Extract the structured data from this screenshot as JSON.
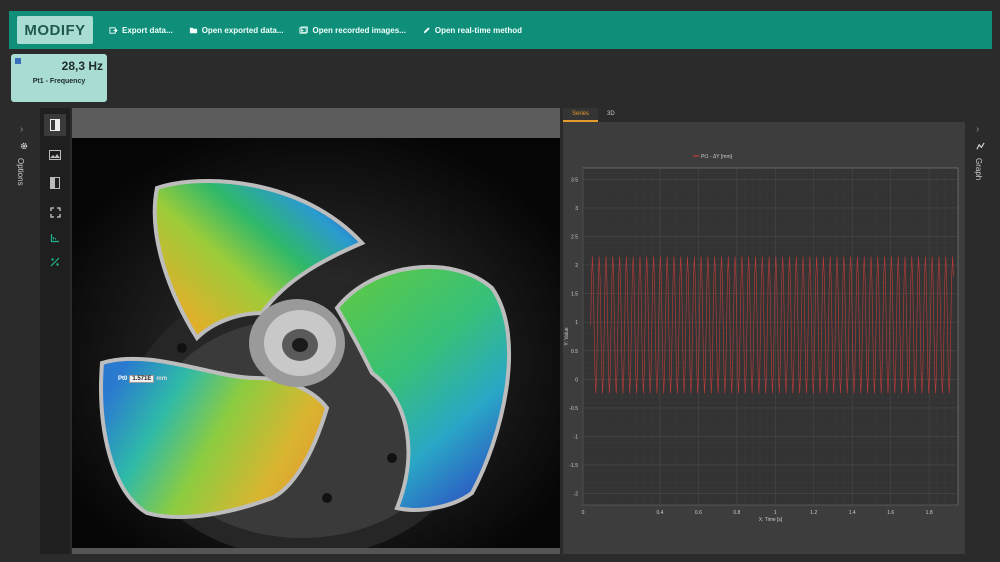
{
  "toolbar": {
    "modify_label": "MODIFY",
    "items": [
      {
        "label": "Export data...",
        "icon": "export-icon"
      },
      {
        "label": "Open exported data...",
        "icon": "folder-icon"
      },
      {
        "label": "Open recorded images...",
        "icon": "images-icon"
      },
      {
        "label": "Open real-time method",
        "icon": "pencil-icon"
      }
    ]
  },
  "frequency_card": {
    "value": "28,3 Hz",
    "label": "Pt1 - Frequency",
    "dot_color": "#3a6fc0"
  },
  "left_rail": {
    "label": "Options",
    "chevron": "›",
    "icon": "gear-icon"
  },
  "right_rail": {
    "label": "Graph",
    "chevron": "›",
    "icon": "graph-icon"
  },
  "tool_column": [
    {
      "icon": "sidebar-toggle-icon",
      "active": true
    },
    {
      "icon": "image-icon",
      "active": false
    },
    {
      "icon": "split-view-icon",
      "active": false
    },
    {
      "icon": "fit-screen-icon",
      "active": false
    },
    {
      "icon": "axes-icon",
      "active": false
    },
    {
      "icon": "measure-icon",
      "active": false
    }
  ],
  "point_label": {
    "name": "Pt0",
    "value": "1.571E",
    "unit": "mm"
  },
  "tabs": [
    {
      "label": "Series",
      "active": true
    },
    {
      "label": "3D",
      "active": false
    }
  ],
  "colors": {
    "toolbar": "#0f8f7a",
    "card": "#a9ddd4",
    "series": "#c23a3a",
    "tab_active": "#e49a2c"
  },
  "chart_data": {
    "type": "line",
    "title": "",
    "xlabel": "X: Time [s]",
    "ylabel": "Y: Value",
    "xlim": [
      0,
      1.95
    ],
    "ylim": [
      -2.2,
      3.7
    ],
    "x_ticks": [
      "0",
      "0.4",
      "0.6",
      "0.8",
      "1",
      "1.2",
      "1.4",
      "1.6",
      "1.8"
    ],
    "x_tick_values": [
      0,
      0.4,
      0.6,
      0.8,
      1,
      1.2,
      1.4,
      1.6,
      1.8
    ],
    "y_ticks": [
      "3.5",
      "3",
      "2.5",
      "2",
      "1.5",
      "1",
      "0.5",
      "0",
      "-0.5",
      "-1",
      "-1.5",
      "-2"
    ],
    "y_tick_values": [
      3.5,
      3,
      2.5,
      2,
      1.5,
      1,
      0.5,
      0,
      -0.5,
      -1,
      -1.5,
      -2
    ],
    "grid": true,
    "legend": "top-left",
    "series": [
      {
        "name": "Pt1 - ΔY [mm]",
        "frequency_hz": 28.3,
        "min": -0.25,
        "max": 2.15,
        "x_start": 0.04,
        "x_end": 1.93
      }
    ]
  }
}
